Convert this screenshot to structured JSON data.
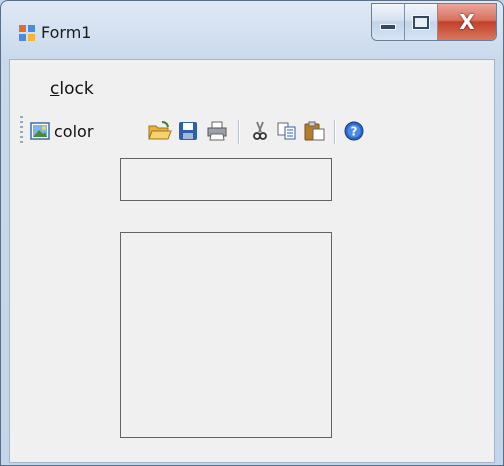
{
  "window": {
    "title": "Form1",
    "icon": "form-window-icon",
    "buttons": {
      "minimize": "minimize-icon",
      "maximize": "maximize-icon",
      "close": "X"
    }
  },
  "menu": {
    "items": [
      {
        "mnemonic": "c",
        "rest": "lock"
      }
    ]
  },
  "toolbar": {
    "items": [
      {
        "icon": "image-icon",
        "label": "color"
      },
      {
        "icon": "open-folder-icon"
      },
      {
        "icon": "save-icon"
      },
      {
        "icon": "print-icon"
      },
      {
        "icon": "cut-icon"
      },
      {
        "icon": "copy-icon"
      },
      {
        "icon": "paste-icon"
      },
      {
        "icon": "help-icon"
      }
    ]
  },
  "fields": {
    "small_value": "",
    "large_value": ""
  }
}
